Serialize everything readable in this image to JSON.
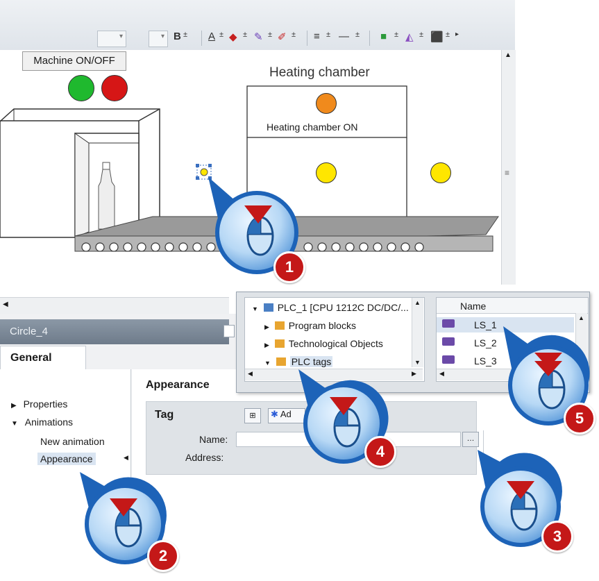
{
  "toolbar": {
    "bold": "B",
    "font_color": "A",
    "items": [
      "B",
      "A",
      "—"
    ]
  },
  "canvas": {
    "machine_button_label": "Machine ON/OFF",
    "heating_chamber_title": "Heating chamber",
    "heating_chamber_on_label": "Heating chamber ON",
    "colors": {
      "green": "#1fb92e",
      "red": "#d61616",
      "orange": "#f08a1c",
      "yellow": "#ffe600"
    }
  },
  "inspector": {
    "object_name": "Circle_4",
    "tab_general": "General",
    "tree": {
      "properties": "Properties",
      "animations": "Animations",
      "new_animation": "New animation",
      "appearance": "Appearance"
    },
    "section_title": "Appearance",
    "group_title": "Tag",
    "name_label": "Name:",
    "address_label": "Address:",
    "name_value": "",
    "add_label": "Ad"
  },
  "popup": {
    "tree": {
      "plc": "PLC_1 [CPU 1212C DC/DC/...",
      "program_blocks": "Program blocks",
      "technological_objects": "Technological Objects",
      "plc_tags": "PLC tags"
    },
    "column_name": "Name",
    "tags": [
      "LS_1",
      "LS_2",
      "LS_3"
    ]
  },
  "callouts": [
    "1",
    "2",
    "3",
    "4",
    "5"
  ]
}
